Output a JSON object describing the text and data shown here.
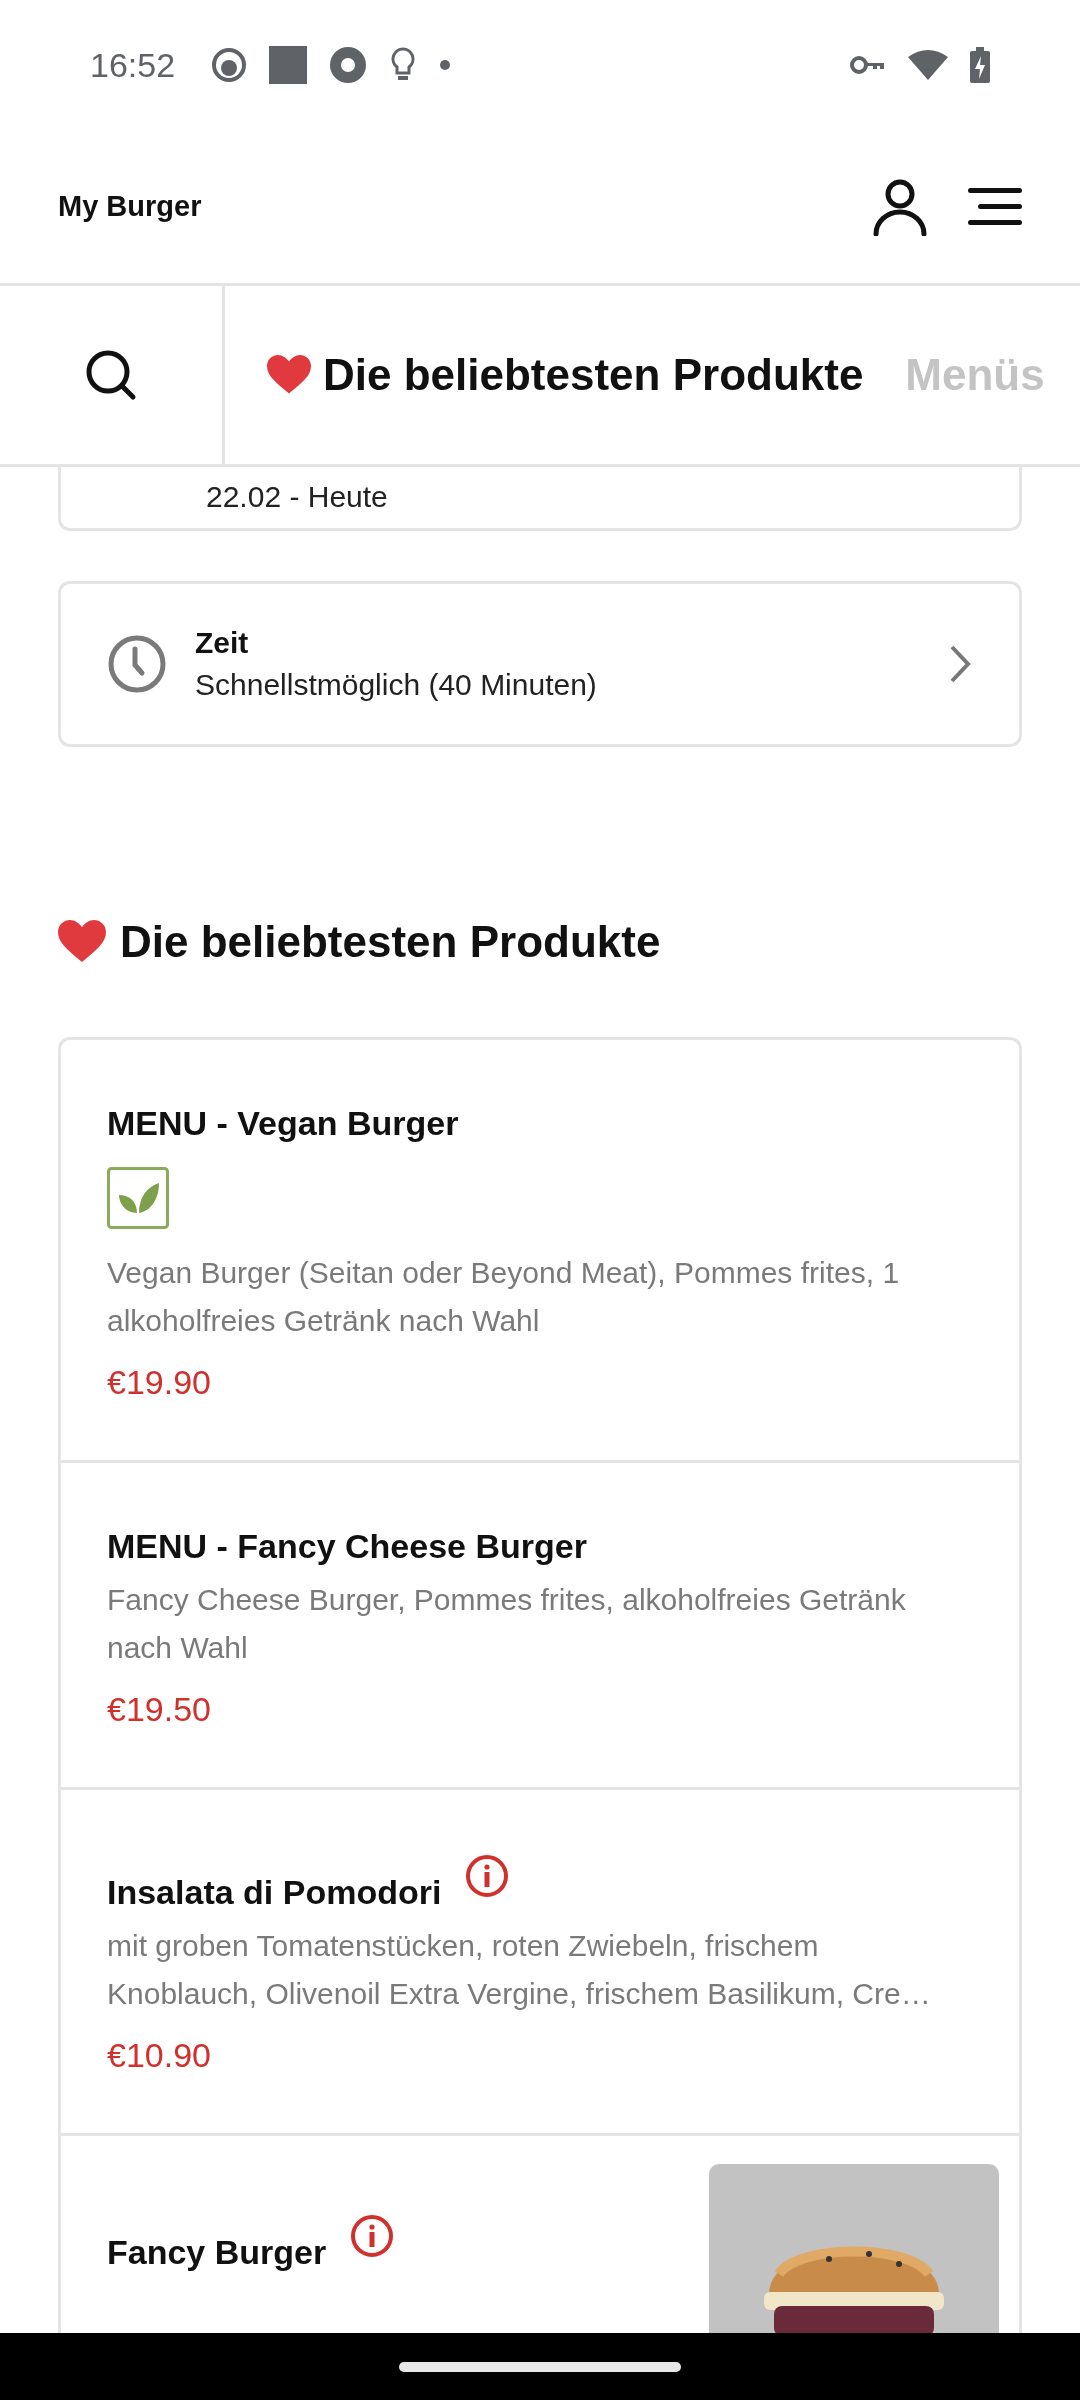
{
  "status_bar": {
    "time": "16:52"
  },
  "header": {
    "title": "My Burger"
  },
  "tabs": [
    {
      "label": "Die beliebtesten Produkte",
      "heart": true,
      "selected": true
    },
    {
      "label": "Menüs",
      "heart": false,
      "selected": false
    }
  ],
  "date_card": {
    "value": "22.02 - Heute"
  },
  "time_card": {
    "label": "Zeit",
    "value": "Schnellstmöglich (40 Minuten)"
  },
  "section": {
    "title": "Die beliebtesten Produkte",
    "heart": true
  },
  "products": [
    {
      "name": "MENU - Vegan Burger",
      "vegan": true,
      "info": false,
      "description": "Vegan Burger (Seitan oder Beyond Meat), Pommes frites, 1 alkoholfreies Getränk nach Wahl",
      "price": "€19.90"
    },
    {
      "name": "MENU - Fancy Cheese Burger",
      "vegan": false,
      "info": false,
      "description": "Fancy Cheese Burger, Pommes frites, alkoholfreies Getränk nach Wahl",
      "price": "€19.50"
    },
    {
      "name": "Insalata di Pomodori",
      "vegan": false,
      "info": true,
      "description": "mit groben Tomatenstücken, roten Zwiebeln, frischem Knoblauch, Olivenoil Extra Vergine, frischem Basilikum, Cre…",
      "price": "€10.90"
    },
    {
      "name": "Fancy Burger",
      "vegan": false,
      "info": true
    }
  ]
}
